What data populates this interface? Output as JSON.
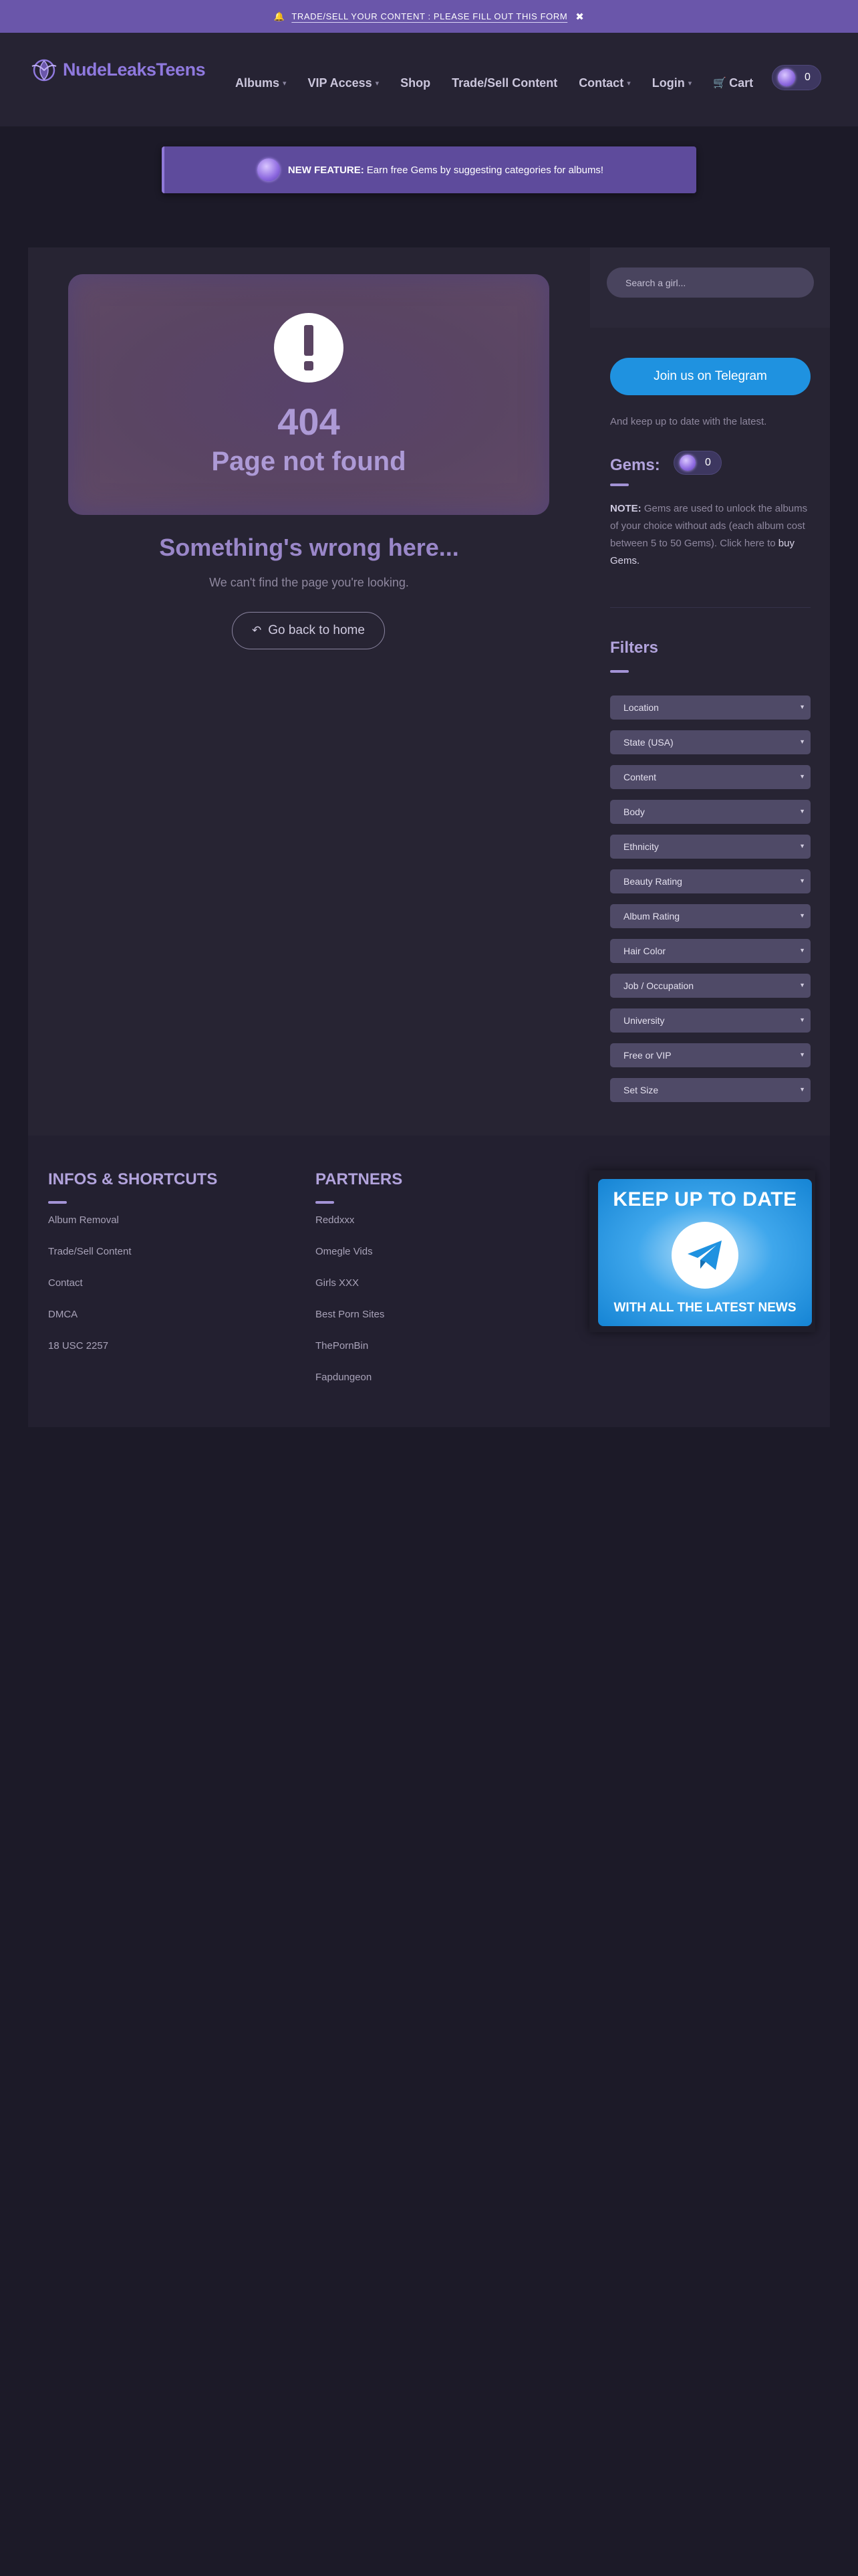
{
  "topbar": {
    "text": "TRADE/SELL YOUR CONTENT : PLEASE FILL OUT THIS FORM"
  },
  "header": {
    "logo": "NudeLeaksTeens",
    "nav": [
      {
        "label": "Albums",
        "caret": true
      },
      {
        "label": "VIP Access",
        "caret": true
      },
      {
        "label": "Shop",
        "caret": false
      },
      {
        "label": "Trade/Sell Content",
        "caret": false
      },
      {
        "label": "Contact",
        "caret": true
      },
      {
        "label": "Login",
        "caret": true
      },
      {
        "label": "Cart",
        "caret": false
      }
    ],
    "gem_count": "0"
  },
  "feature": {
    "label": "NEW FEATURE:",
    "text": "Earn free Gems by suggesting categories for albums!"
  },
  "error": {
    "code": "404",
    "title": "Page not found",
    "heading": "Something's wrong here...",
    "subtext": "We can't find the page you're looking.",
    "home_button": "Go back to home"
  },
  "sidebar": {
    "search_placeholder": "Search a girl...",
    "telegram_button": "Join us on Telegram",
    "telegram_sub": "And keep up to date with the latest.",
    "gems_label": "Gems:",
    "gems_value": "0",
    "note_label": "NOTE:",
    "note_text": "Gems are used to unlock the albums of your choice without ads (each album cost between 5 to 50 Gems). Click here to",
    "note_link": "buy Gems.",
    "filters_title": "Filters",
    "filters": [
      "Location",
      "State (USA)",
      "Content",
      "Body",
      "Ethnicity",
      "Beauty Rating",
      "Album Rating",
      "Hair Color",
      "Job / Occupation",
      "University",
      "Free or VIP",
      "Set Size"
    ]
  },
  "footer": {
    "infos_title": "INFOS & SHORTCUTS",
    "infos_links": [
      "Album Removal",
      "Trade/Sell Content",
      "Contact",
      "DMCA",
      "18 USC 2257"
    ],
    "partners_title": "PARTNERS",
    "partners_links": [
      "Reddxxx",
      "Omegle Vids",
      "Girls XXX",
      "Best Porn Sites",
      "ThePornBin",
      "Fapdungeon"
    ],
    "ad_top": "KEEP UP TO DATE",
    "ad_bottom": "WITH ALL THE LATEST NEWS"
  }
}
